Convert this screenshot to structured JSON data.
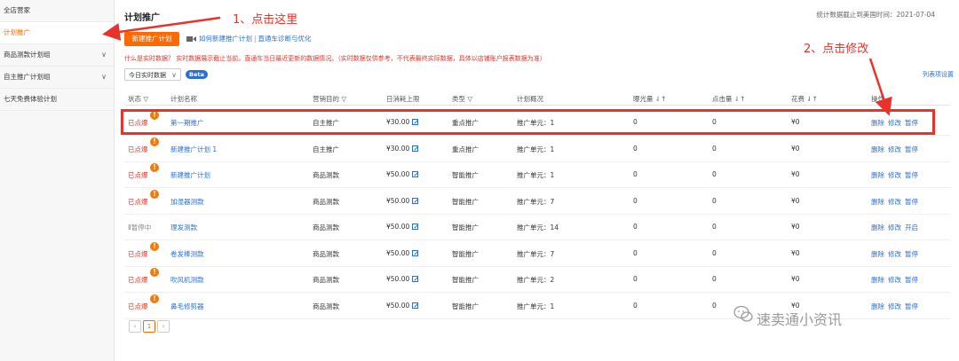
{
  "sidebar": {
    "items": [
      {
        "label": "全店营家",
        "chevron": false,
        "active": false
      },
      {
        "label": "计划推广",
        "chevron": false,
        "active": true
      },
      {
        "label": "商品测款计划组",
        "chevron": true,
        "active": false
      },
      {
        "label": "自主推广计划组",
        "chevron": true,
        "active": false
      },
      {
        "label": "七天免费体验计划",
        "chevron": false,
        "active": false
      }
    ],
    "chevron_glyph": "∨"
  },
  "header": {
    "title": "计划推广",
    "stat_label": "统计数据截止到美国时间：",
    "stat_date": "2021-07-04"
  },
  "toolbar": {
    "new_plan_label": "新建推广计划",
    "video_icon": "video-icon",
    "help_link": "如何新建推广计划",
    "help_sep": "|",
    "diag_link": "直通车诊断与优化"
  },
  "notice": "什么是实时数据？ 实时数据展示截止当前。直通车当日最近更新的数据情况。（实时数据仅供参考，不代表最终实际数据，具体以店铺账户报表数据为准）",
  "filter": {
    "date_value": "今日实时数据",
    "beta": "Beta",
    "col_settings": "列表项设置"
  },
  "table": {
    "headers": {
      "status": "状态 ▽",
      "name": "计划名称",
      "goal": "营销目的 ▽",
      "budget": "日消耗上限",
      "type": "类型 ▽",
      "overview": "计划概况",
      "impressions": "曝光量 ⇃↑",
      "clicks": "点击量 ⇃↑",
      "cost": "花费 ⇃↑",
      "ops": "操作"
    },
    "rows": [
      {
        "status": "已点爆",
        "alert": "!",
        "name": "第一期推广",
        "goal": "自主推广",
        "budget": "¥30.00",
        "type": "重点推广",
        "overview": "推广单元：1",
        "impressions": "0",
        "clicks": "0",
        "cost": "¥0",
        "ops": [
          "删除",
          "修改",
          "暂停"
        ]
      },
      {
        "status": "已点爆",
        "alert": "!",
        "name": "新建推广计划 1",
        "goal": "自主推广",
        "budget": "¥30.00",
        "type": "重点推广",
        "overview": "推广单元：1",
        "impressions": "0",
        "clicks": "0",
        "cost": "¥0",
        "ops": [
          "删除",
          "修改",
          "暂停"
        ]
      },
      {
        "status": "已点爆",
        "alert": "!",
        "name": "新建推广计划",
        "goal": "商品测款",
        "budget": "¥50.00",
        "type": "智能推广",
        "overview": "推广单元：1",
        "impressions": "0",
        "clicks": "0",
        "cost": "¥0",
        "ops": [
          "删除",
          "修改",
          "暂停"
        ]
      },
      {
        "status": "已点爆",
        "alert": "!",
        "name": "加湿器测款",
        "goal": "商品测款",
        "budget": "¥50.00",
        "type": "智能推广",
        "overview": "推广单元：7",
        "impressions": "0",
        "clicks": "0",
        "cost": "¥0",
        "ops": [
          "删除",
          "修改",
          "暂停"
        ]
      },
      {
        "status": "Ⅱ暂停中",
        "alert": "",
        "name": "理发测款",
        "goal": "商品测款",
        "budget": "¥50.00",
        "type": "智能推广",
        "overview": "推广单元：14",
        "impressions": "0",
        "clicks": "0",
        "cost": "¥0",
        "ops": [
          "删除",
          "修改",
          "开启"
        ]
      },
      {
        "status": "已点爆",
        "alert": "!",
        "name": "卷发棒测款",
        "goal": "商品测款",
        "budget": "¥50.00",
        "type": "智能推广",
        "overview": "推广单元：7",
        "impressions": "0",
        "clicks": "0",
        "cost": "¥0",
        "ops": [
          "删除",
          "修改",
          "暂停"
        ]
      },
      {
        "status": "已点爆",
        "alert": "!",
        "name": "吹风机测款",
        "goal": "商品测款",
        "budget": "¥50.00",
        "type": "智能推广",
        "overview": "推广单元：2",
        "impressions": "0",
        "clicks": "0",
        "cost": "¥0",
        "ops": [
          "删除",
          "修改",
          "暂停"
        ]
      },
      {
        "status": "已点爆",
        "alert": "!",
        "name": "鼻毛修剪器",
        "goal": "商品测款",
        "budget": "¥50.00",
        "type": "智能推广",
        "overview": "推广单元：1",
        "impressions": "0",
        "clicks": "0",
        "cost": "¥0",
        "ops": [
          "删除",
          "修改",
          "暂停"
        ]
      }
    ]
  },
  "pager": {
    "prev": "‹",
    "current": "1",
    "next": "›"
  },
  "annotations": {
    "step1": "1、点击这里",
    "step2": "2、点击修改",
    "color": "#e8322b"
  },
  "watermark": "速卖通小资讯"
}
